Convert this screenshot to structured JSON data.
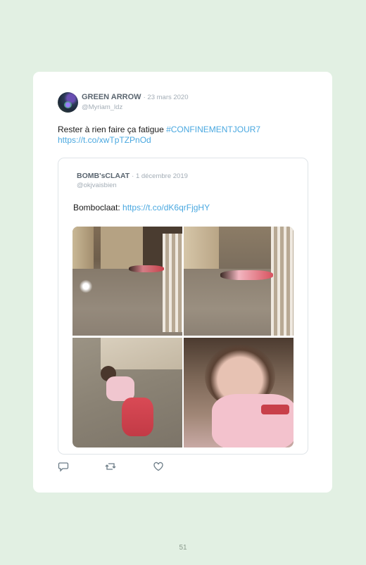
{
  "tweet": {
    "author_name": "GREEN ARROW",
    "date": "· 23 mars 2020",
    "handle": "@Myriam_ldz",
    "text": "Rester à rien faire ça fatigue ",
    "hashtag": "#CONFINEMENTJOUR7",
    "link": "https://t.co/xwTpTZPnOd"
  },
  "quoted_tweet": {
    "author_name": "BOMB'sCLAAT",
    "date": "· 1 décembre 2019",
    "handle": "@okjvaisbien",
    "text": "Bomboclaat: ",
    "link": "https://t.co/dK6qrFjgHY"
  },
  "actions": {
    "reply_icon": "reply-icon",
    "retweet_icon": "retweet-icon",
    "like_icon": "like-icon"
  },
  "page_number": "51"
}
